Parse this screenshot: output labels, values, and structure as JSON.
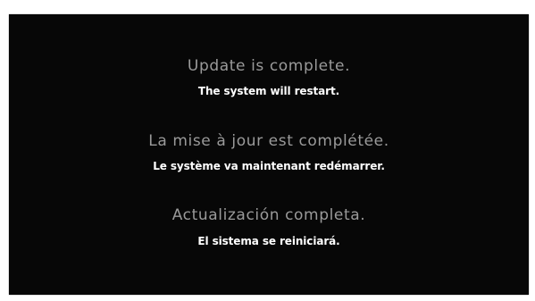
{
  "messages": {
    "english": {
      "headline": "Update is complete.",
      "detail": "The system will restart."
    },
    "french": {
      "headline": "La mise à jour est complétée.",
      "detail": "Le système va maintenant redémarrer."
    },
    "spanish": {
      "headline": "Actualización completa.",
      "detail": "El sistema se reiniciará."
    }
  },
  "colors": {
    "background": "#070707",
    "headline_text": "#9a9a9a",
    "detail_text": "#ffffff"
  }
}
